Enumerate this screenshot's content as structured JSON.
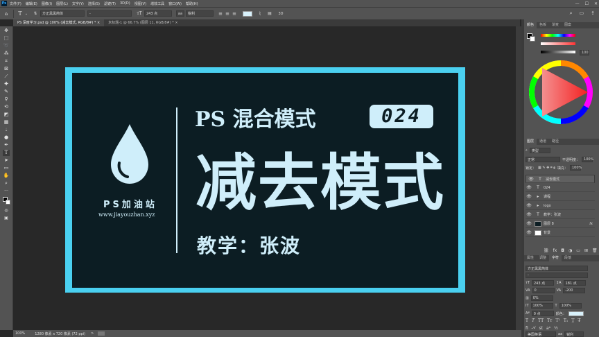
{
  "app": {
    "logo": "Ps",
    "accent": "#31a8ff"
  },
  "menu": [
    "文件(F)",
    "编辑(E)",
    "图像(I)",
    "图层(L)",
    "文字(Y)",
    "选择(S)",
    "滤镜(T)",
    "3D(D)",
    "视图(V)",
    "增效工具",
    "窗口(W)",
    "帮助(H)"
  ],
  "window_controls": {
    "minimize": "—",
    "maximize": "☐",
    "close": "✕"
  },
  "options": {
    "font_family": "方正黑黑简体",
    "font_style": "-",
    "font_size": "243 点",
    "antialias": "锐利",
    "text_color": "#d8f1fb"
  },
  "tabs": [
    {
      "label": "PS 深度学习.psd @ 100% (减去模式, RGB/8#) *",
      "close": "×"
    },
    {
      "label": "未标题-1 @ 66.7% (图层 11, RGB/8#) *",
      "close": "×"
    }
  ],
  "artwork": {
    "border_color": "#4ad0f0",
    "bg_color": "#0c1d23",
    "text_color": "#cfeefa",
    "headline_small": "PS 混合模式",
    "badge_number": "024",
    "headline_big": "减去模式",
    "teacher": "教学：张波",
    "logo_name": "PS加油站",
    "logo_url": "www.jiayouzhan.xyz"
  },
  "status": {
    "zoom": "100%",
    "doc_info": "1280 像素 x 720 像素 (72 ppi)",
    "arrow": ">"
  },
  "color_panel": {
    "tabs": [
      "颜色",
      "色板",
      "渐变",
      "图案"
    ],
    "slider_value": "100"
  },
  "layers_panel": {
    "tabs": [
      "图层",
      "通道",
      "路径"
    ],
    "filter_type": "类型",
    "blend_mode": "正常",
    "opacity_label": "不透明度：",
    "opacity": "100%",
    "lock_label": "锁定：",
    "fill_label": "填充：",
    "fill": "100%",
    "layers": [
      {
        "name": "减去模式",
        "thumb": "T"
      },
      {
        "name": "024",
        "thumb": "T"
      },
      {
        "name": "课程",
        "thumb": "▸"
      },
      {
        "name": "logo",
        "thumb": "▸"
      },
      {
        "name": "教学：张波",
        "thumb": "T"
      },
      {
        "name": "图层 8",
        "thumb": "",
        "fx": "fx"
      },
      {
        "name": "背景",
        "thumb": ""
      }
    ]
  },
  "char_panel": {
    "tabs": [
      "属性",
      "调整",
      "字符",
      "段落"
    ],
    "font": "方正黑黑简体",
    "style": "-",
    "size": "243 点",
    "leading": "181 点",
    "kerning": "0",
    "tracking": "-200",
    "scale_pct": "0%",
    "vscale": "100%",
    "hscale": "100%",
    "baseline": "0 点",
    "color_label": "颜色：",
    "language": "美国英语",
    "aa": "锐利"
  }
}
